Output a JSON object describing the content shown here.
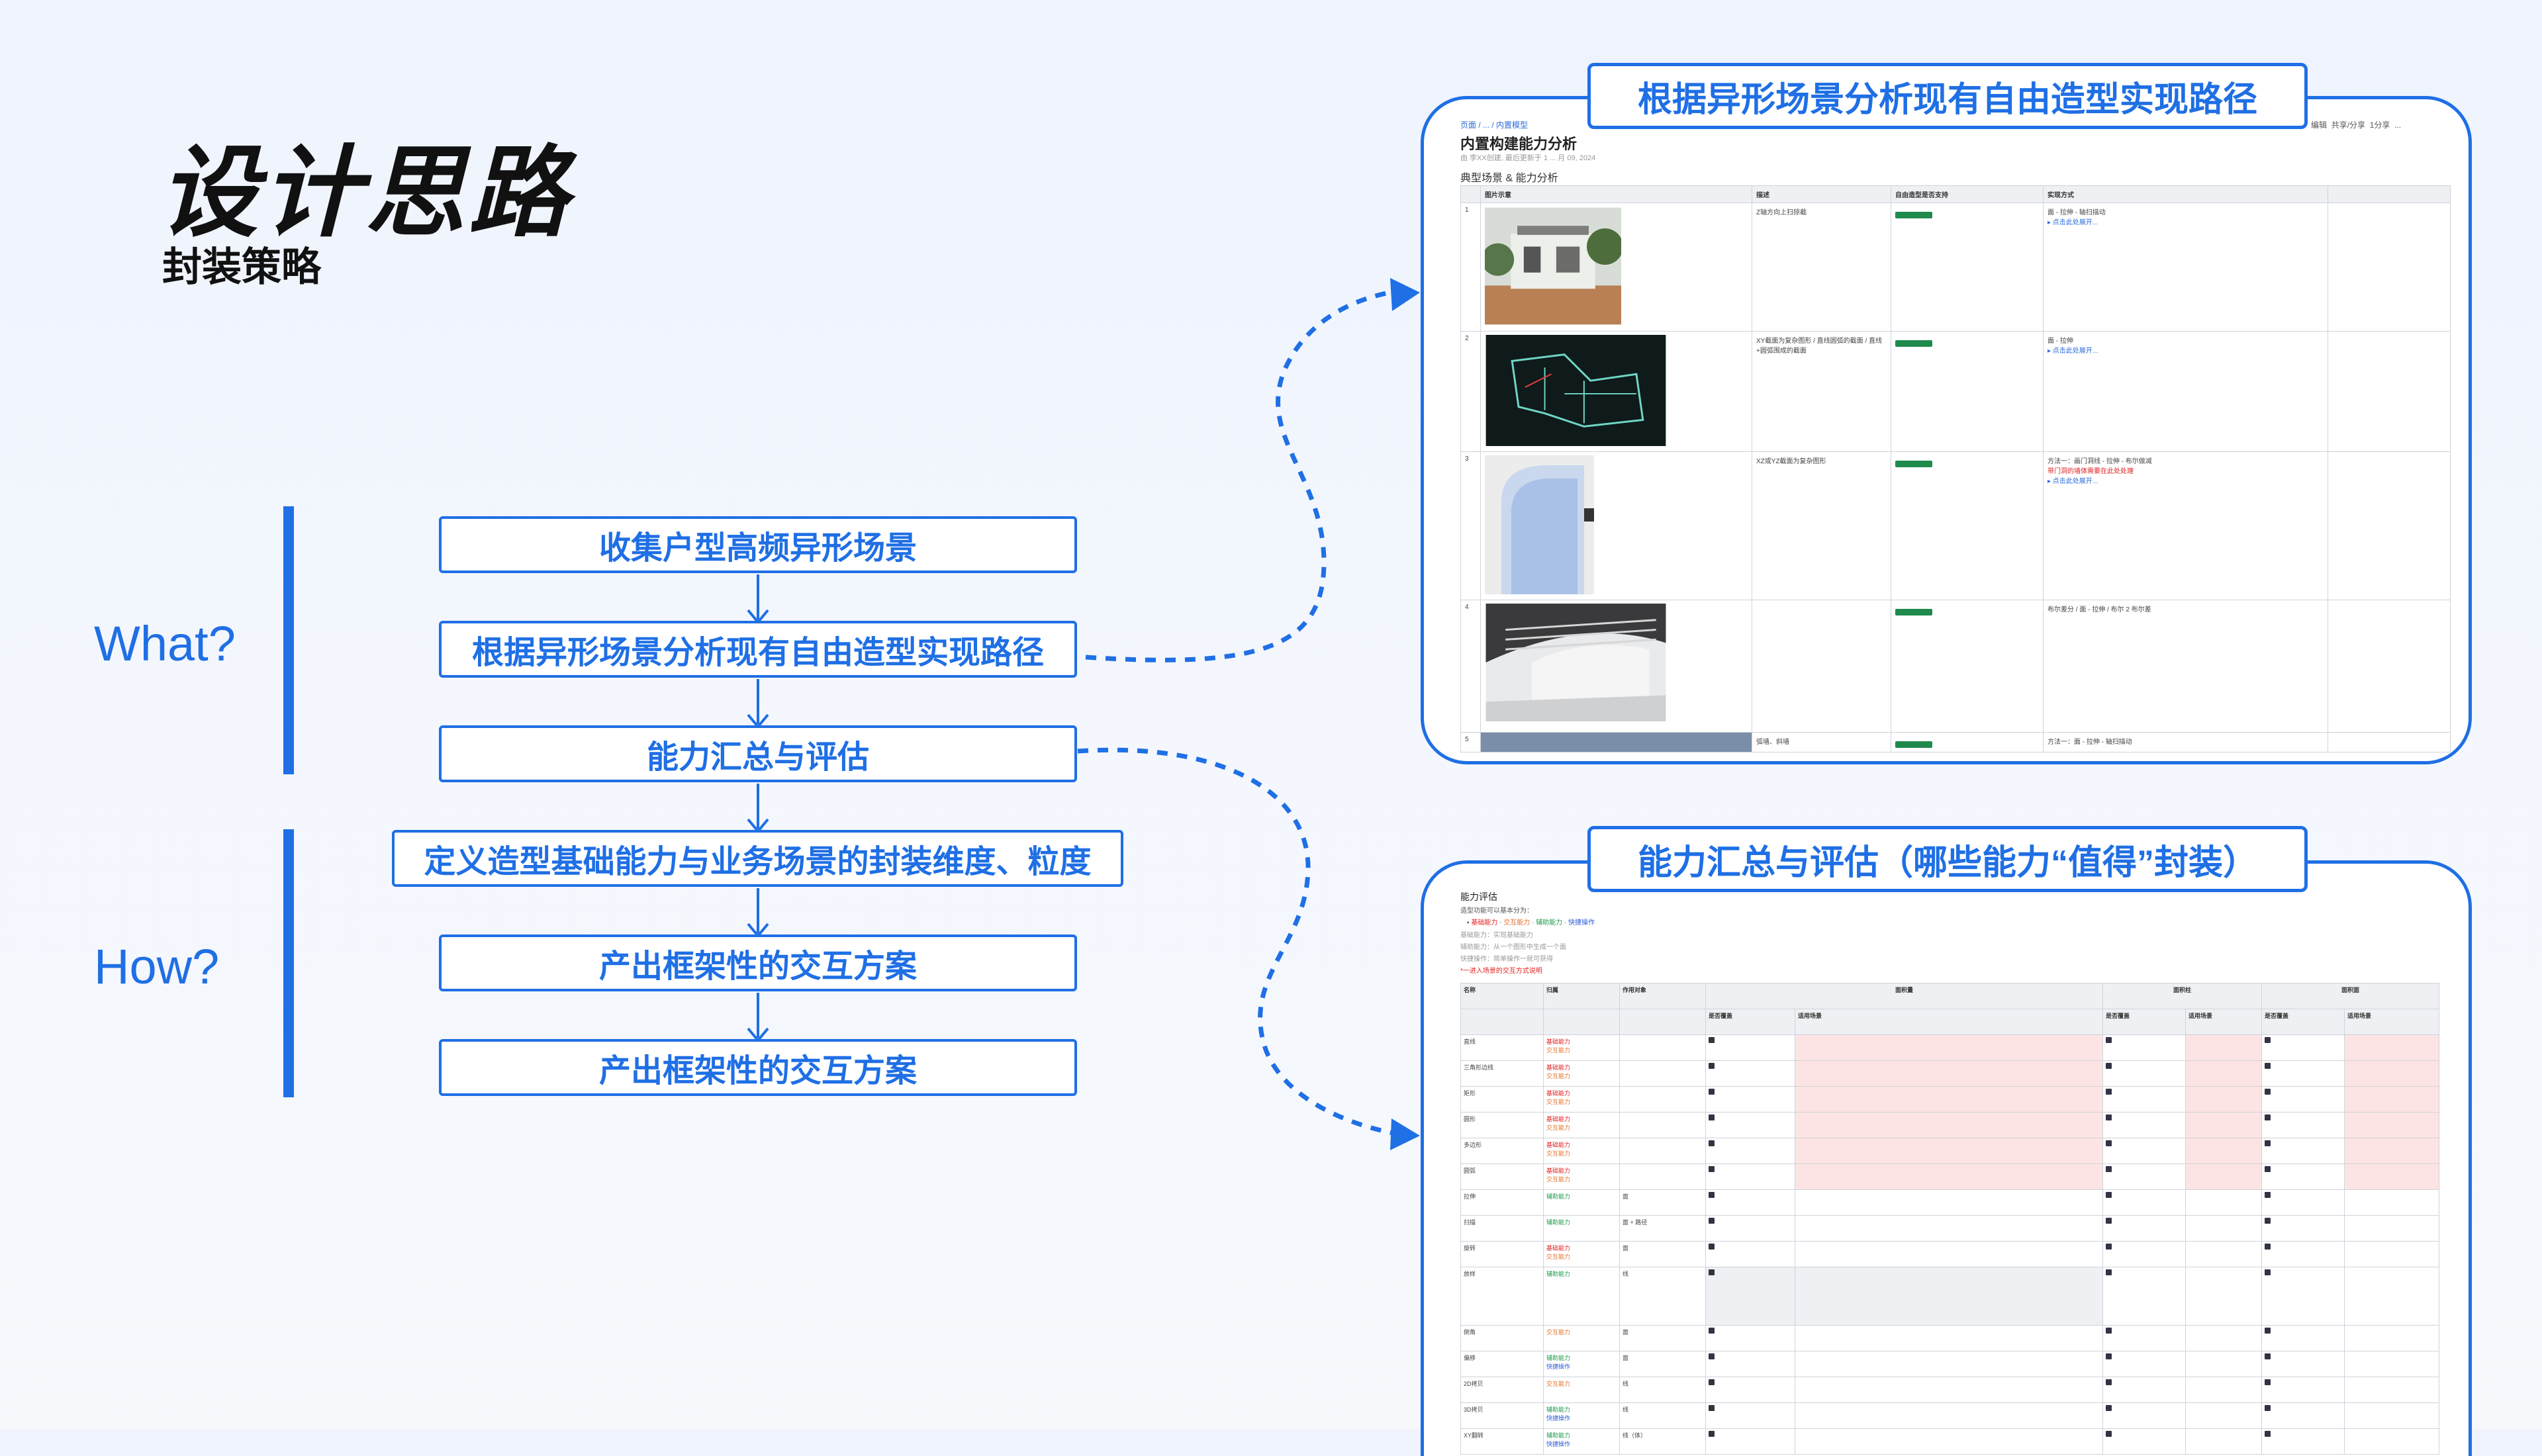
{
  "header": {
    "title": "设计思路",
    "subtitle": "封装策略"
  },
  "sections": {
    "what": "What?",
    "how": "How?"
  },
  "flow_steps": [
    "收集户型高频异形场景",
    "根据异形场景分析现有自由造型实现路径",
    "能力汇总与评估",
    "定义造型基础能力与业务场景的封装维度、粒度",
    "产出框架性的交互方案",
    "产出框架性的交互方案"
  ],
  "cards": {
    "top": {
      "title": "根据异形场景分析现有自由造型实现路径",
      "doc": {
        "breadcrumb": "页面 / ... / 内置模型",
        "title": "内置构建能力分析",
        "meta": "由 李XX创建, 最后更新于 1 ... 月 09, 2024",
        "toolbar": [
          "编辑",
          "共享/分享",
          "1分享",
          "..."
        ],
        "section": "典型场景 & 能力分析",
        "columns": [
          "图片示意",
          "描述",
          "自由造型是否支持",
          "实现方式"
        ],
        "rows": [
          {
            "num": "1",
            "desc": "Z轴方向上扫掠截",
            "support": "支持",
            "impl": "面 - 拉伸 - 轴扫描动",
            "link": "▸ 点击此处展开..."
          },
          {
            "num": "2",
            "desc": "XY截面为复杂图形 / 直线圆弧的截面 / 直线+圆弧围成的截面",
            "support": "支持",
            "impl": "面 - 拉伸",
            "link": "▸ 点击此处展开..."
          },
          {
            "num": "3",
            "desc": "XZ或YZ截面为复杂图形",
            "support": "支持",
            "impl": "方法一：画门洞线 - 拉伸 - 布尔做减",
            "link": "▸ 点击此处展开..."
          },
          {
            "num": "4",
            "desc": "",
            "support": "支持",
            "impl": "布尔差分 / 面 - 拉伸 / 布尔 2 布尔差",
            "link": ""
          },
          {
            "num": "5",
            "desc": "弧墙、斜墙",
            "support": "支持",
            "impl": "方法一：面 - 拉伸 - 轴扫描动",
            "link": ""
          }
        ]
      }
    },
    "bottom": {
      "title": "能力汇总与评估（哪些能力“值得”封装）",
      "doc": {
        "heading": "能力评估",
        "intro": "造型功能可以基本分为：",
        "legend": [
          "基础能力",
          "交互能力",
          "辅助能力",
          "快捷操作"
        ],
        "notes": [
          "基础能力：实现基础能力",
          "辅助能力：从一个图形中生成一个面",
          "快捷操作：简单操作一就可获得",
          "*一进入场景的交互方式说明"
        ],
        "columns": [
          "名称",
          "归属",
          "作用对象",
          "面积量",
          "面积柱",
          "面积面"
        ],
        "subcolumns": [
          "是否覆盖",
          "适用场景"
        ],
        "rows": [
          {
            "name": "直线",
            "cat": "基础能力",
            "cat2": "交互能力",
            "obj": ""
          },
          {
            "name": "三角形边线",
            "cat": "基础能力",
            "cat2": "交互能力",
            "obj": ""
          },
          {
            "name": "矩形",
            "cat": "基础能力",
            "cat2": "交互能力",
            "obj": ""
          },
          {
            "name": "圆形",
            "cat": "基础能力",
            "cat2": "交互能力",
            "obj": ""
          },
          {
            "name": "多边形",
            "cat": "基础能力",
            "cat2": "交互能力",
            "obj": ""
          },
          {
            "name": "圆弧",
            "cat": "基础能力",
            "cat2": "交互能力",
            "obj": ""
          },
          {
            "name": "拉伸",
            "cat": "辅助能力",
            "cat2": "",
            "obj": "面"
          },
          {
            "name": "扫描",
            "cat": "辅助能力",
            "cat2": "",
            "obj": "面 + 路径"
          },
          {
            "name": "旋转",
            "cat": "基础能力",
            "cat2": "交互能力",
            "obj": "面"
          },
          {
            "name": "放样",
            "cat": "辅助能力",
            "cat2": "",
            "obj": "线"
          },
          {
            "name": "倒角",
            "cat": "交互能力",
            "cat2": "",
            "obj": "面"
          },
          {
            "name": "偏移",
            "cat": "辅助能力",
            "cat2": "快捷操作",
            "obj": "面"
          },
          {
            "name": "2D拷贝",
            "cat": "交互能力",
            "cat2": "",
            "obj": "线"
          },
          {
            "name": "3D拷贝",
            "cat": "辅助能力",
            "cat2": "快捷操作",
            "obj": "线"
          },
          {
            "name": "XY翻转",
            "cat": "辅助能力",
            "cat2": "快捷操作",
            "obj": "线（体）"
          }
        ]
      }
    }
  },
  "colors": {
    "accent": "#1f6fe5",
    "text": "#111111",
    "support_tag": "#1e8a4c",
    "pink_cell": "#fde4e4"
  }
}
